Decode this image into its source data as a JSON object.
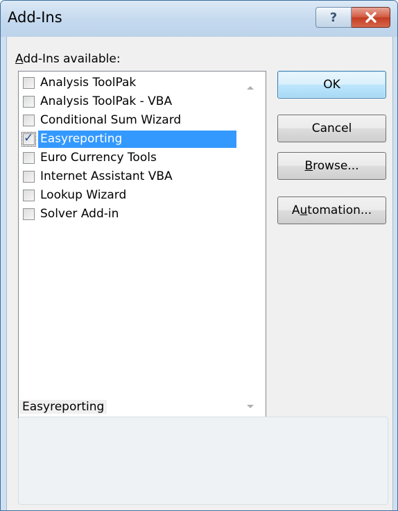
{
  "window": {
    "title": "Add-Ins",
    "help_glyph": "?"
  },
  "caption": {
    "accel": "A",
    "rest": "dd-Ins available:"
  },
  "addins": [
    {
      "label": "Analysis ToolPak",
      "checked": false,
      "selected": false
    },
    {
      "label": "Analysis ToolPak - VBA",
      "checked": false,
      "selected": false
    },
    {
      "label": "Conditional Sum Wizard",
      "checked": false,
      "selected": false
    },
    {
      "label": "Easyreporting",
      "checked": true,
      "selected": true
    },
    {
      "label": "Euro Currency Tools",
      "checked": false,
      "selected": false
    },
    {
      "label": "Internet Assistant VBA",
      "checked": false,
      "selected": false
    },
    {
      "label": "Lookup Wizard",
      "checked": false,
      "selected": false
    },
    {
      "label": "Solver Add-in",
      "checked": false,
      "selected": false
    }
  ],
  "check_glyph": "✓",
  "buttons": {
    "ok": "OK",
    "cancel": "Cancel",
    "browse_accel": "B",
    "browse_rest": "rowse...",
    "automation_pre": "A",
    "automation_accel": "u",
    "automation_rest": "tomation..."
  },
  "description": {
    "title": "Easyreporting",
    "text": ""
  },
  "colors": {
    "selection": "#3399ff",
    "close_button": "#c8452b",
    "default_button": "#bee6fd"
  }
}
